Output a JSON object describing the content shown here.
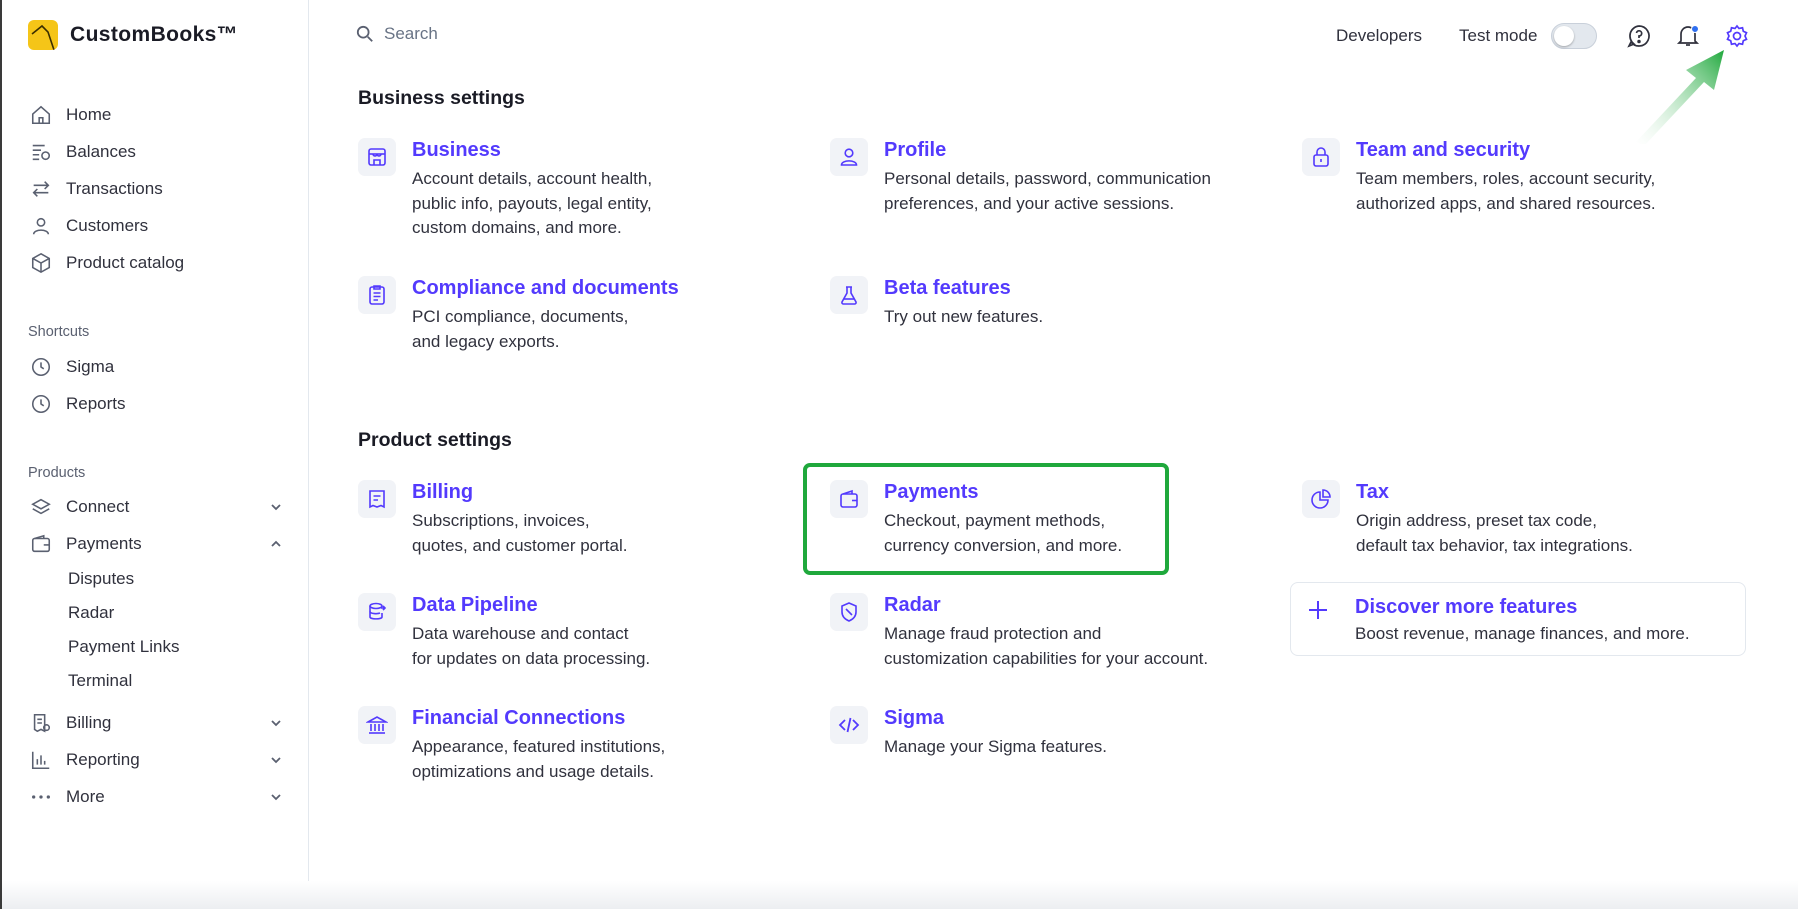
{
  "brand": {
    "name": "CustomBooks™"
  },
  "sidebar": {
    "main_items": [
      {
        "label": "Home",
        "icon": "home-icon"
      },
      {
        "label": "Balances",
        "icon": "balances-icon"
      },
      {
        "label": "Transactions",
        "icon": "arrows-icon"
      },
      {
        "label": "Customers",
        "icon": "person-icon"
      },
      {
        "label": "Product catalog",
        "icon": "cube-icon"
      }
    ],
    "shortcuts_label": "Shortcuts",
    "shortcuts": [
      {
        "label": "Sigma",
        "icon": "clock-icon"
      },
      {
        "label": "Reports",
        "icon": "clock-icon"
      }
    ],
    "products_label": "Products",
    "products": [
      {
        "label": "Connect",
        "icon": "layers-icon",
        "expanded": false
      },
      {
        "label": "Payments",
        "icon": "wallet-icon",
        "expanded": true
      },
      {
        "label": "Billing",
        "icon": "invoice-icon",
        "expanded": false
      },
      {
        "label": "Reporting",
        "icon": "bar-chart-icon",
        "expanded": false
      },
      {
        "label": "More",
        "icon": "more-dots-icon",
        "expanded": false
      }
    ],
    "payments_subitems": [
      "Disputes",
      "Radar",
      "Payment Links",
      "Terminal"
    ]
  },
  "topbar": {
    "search_placeholder": "Search",
    "developers": "Developers",
    "test_mode": "Test mode",
    "test_mode_on": false,
    "notification_unread": true
  },
  "business_settings": {
    "title": "Business settings",
    "cards": [
      {
        "title": "Business",
        "desc": "Account details, account health,\npublic info, payouts, legal entity,\ncustom domains, and more.",
        "icon": "store-icon"
      },
      {
        "title": "Profile",
        "desc": "Personal details, password, communication\npreferences, and your active sessions.",
        "icon": "person-icon"
      },
      {
        "title": "Team and security",
        "desc": "Team members, roles, account security,\nauthorized apps, and shared resources.",
        "icon": "lock-icon"
      },
      {
        "title": "Compliance and documents",
        "desc": "PCI compliance, documents,\nand legacy exports.",
        "icon": "document-icon"
      },
      {
        "title": "Beta features",
        "desc": "Try out new features.",
        "icon": "flask-icon"
      }
    ]
  },
  "product_settings": {
    "title": "Product settings",
    "cards": [
      {
        "title": "Billing",
        "desc": "Subscriptions, invoices,\nquotes, and customer portal.",
        "icon": "invoice-icon"
      },
      {
        "title": "Payments",
        "desc": "Checkout, payment methods,\ncurrency conversion, and more.",
        "icon": "wallet-icon"
      },
      {
        "title": "Tax",
        "desc": "Origin address, preset tax code,\ndefault tax behavior, tax integrations.",
        "icon": "pie-icon"
      },
      {
        "title": "Data Pipeline",
        "desc": "Data warehouse and contact\nfor updates on data processing.",
        "icon": "database-icon"
      },
      {
        "title": "Radar",
        "desc": "Manage fraud protection and\ncustomization capabilities for your account.",
        "icon": "shield-icon"
      },
      {
        "title": "Financial Connections",
        "desc": "Appearance, featured institutions,\noptimizations and usage details.",
        "icon": "bank-icon"
      },
      {
        "title": "Sigma",
        "desc": "Manage your Sigma features.",
        "icon": "code-icon"
      }
    ],
    "discover": {
      "title": "Discover more features",
      "desc": "Boost revenue, manage finances, and more."
    }
  },
  "colors": {
    "accent": "#533afd",
    "highlight": "#1fa83c",
    "brand": "#f5c518"
  }
}
